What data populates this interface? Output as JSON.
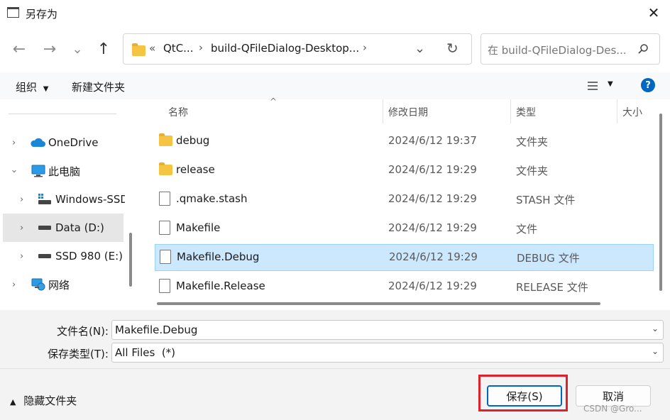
{
  "window": {
    "title": "另存为",
    "close": "✕"
  },
  "nav": {
    "back": "←",
    "forward": "→",
    "recent": "⌄",
    "up": "↑",
    "breadcrumb": [
      "«",
      "QtC...",
      "build-QFileDialog-Desktop..."
    ],
    "sep": "›",
    "refresh": "↻",
    "search_placeholder": "在 build-QFileDialog-Des..."
  },
  "toolbar": {
    "organize": "组织",
    "new_folder": "新建文件夹",
    "help": "?"
  },
  "tree": [
    {
      "label": "OneDrive",
      "icon": "cloud-icon"
    },
    {
      "label": "此电脑",
      "icon": "computer-icon"
    },
    {
      "label": "Windows-SSD",
      "icon": "drive-icon"
    },
    {
      "label": "Data (D:)",
      "icon": "drive-icon"
    },
    {
      "label": "SSD 980 (E:)",
      "icon": "drive-icon"
    },
    {
      "label": "网络",
      "icon": "network-icon"
    }
  ],
  "columns": {
    "name": "名称",
    "date": "修改日期",
    "type": "类型",
    "size": "大小"
  },
  "files": [
    {
      "name": "debug",
      "date": "2024/6/12 19:37",
      "type": "文件夹",
      "kind": "folder"
    },
    {
      "name": "release",
      "date": "2024/6/12 19:29",
      "type": "文件夹",
      "kind": "folder"
    },
    {
      "name": ".qmake.stash",
      "date": "2024/6/12 19:29",
      "type": "STASH 文件",
      "kind": "file"
    },
    {
      "name": "Makefile",
      "date": "2024/6/12 19:29",
      "type": "文件",
      "kind": "file"
    },
    {
      "name": "Makefile.Debug",
      "date": "2024/6/12 19:29",
      "type": "DEBUG 文件",
      "kind": "file"
    },
    {
      "name": "Makefile.Release",
      "date": "2024/6/12 19:29",
      "type": "RELEASE 文件",
      "kind": "file"
    }
  ],
  "form": {
    "filename_label": "文件名(N):",
    "filename_value": "Makefile.Debug",
    "filetype_label": "保存类型(T):",
    "filetype_value": "All Files  (*)"
  },
  "footer": {
    "hide_folders": "隐藏文件夹",
    "save": "保存(S)",
    "cancel": "取消",
    "watermark": "CSDN @Gro..."
  },
  "colors": {
    "accent": "#0067c0",
    "selection": "#cce8ff",
    "highlight_box": "#e0202a"
  }
}
